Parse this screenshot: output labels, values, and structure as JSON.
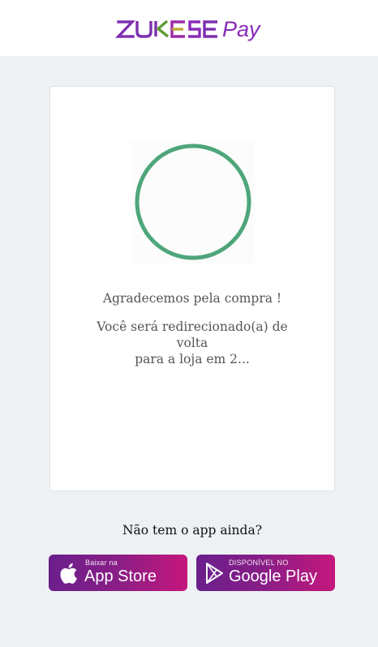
{
  "header": {
    "logo_text": "ZUKESE Pay",
    "logo_part1": "ZUKESE",
    "logo_part2": "Pay"
  },
  "status": {
    "thank_you": "Agradecemos pela compra !",
    "redirect_line1": "Você será redirecionado(a) de volta",
    "redirect_line2": "para a loja em 2...",
    "spinner_color": "#4ea67a"
  },
  "app_promo": {
    "prompt": "Não tem o app ainda?",
    "app_store": {
      "small_label": "Baixar na",
      "big_label": "App Store",
      "icon": "apple-icon"
    },
    "google_play": {
      "small_label": "DISPONÍVEL NO",
      "big_label": "Google Play",
      "icon": "play-store-icon"
    }
  },
  "colors": {
    "brand_purple": "#8a2bb8",
    "brand_green": "#5c9a2f",
    "button_gradient_start": "#6a1f8c",
    "button_gradient_end": "#c5177c"
  }
}
